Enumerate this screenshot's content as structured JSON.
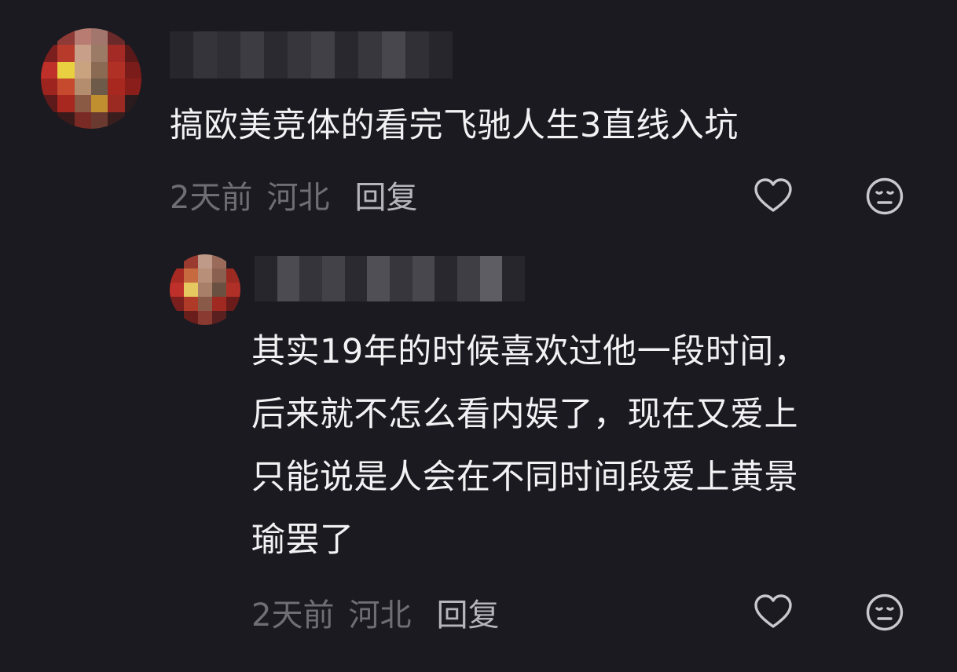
{
  "comments": [
    {
      "text": "搞欧美竞体的看完飞驰人生3直线入坑",
      "time": "2天前",
      "location": "河北",
      "reply_label": "回复",
      "like_icon": "heart-outline-icon",
      "reaction_icon": "meh-face-icon"
    },
    {
      "text": "其实19年的时候喜欢过他一段时间，\n后来就不怎么看内娱了，现在又爱上\n只能说是人会在不同时间段爱上黄景\n瑜罢了",
      "time": "2天前",
      "location": "河北",
      "reply_label": "回复",
      "like_icon": "heart-outline-icon",
      "reaction_icon": "meh-face-icon"
    }
  ],
  "colors": {
    "background": "#1b1a20",
    "text": "#f2f2f4",
    "meta": "#6f6e75",
    "reply": "#b6b5bb",
    "icon": "#c9c8cd"
  }
}
